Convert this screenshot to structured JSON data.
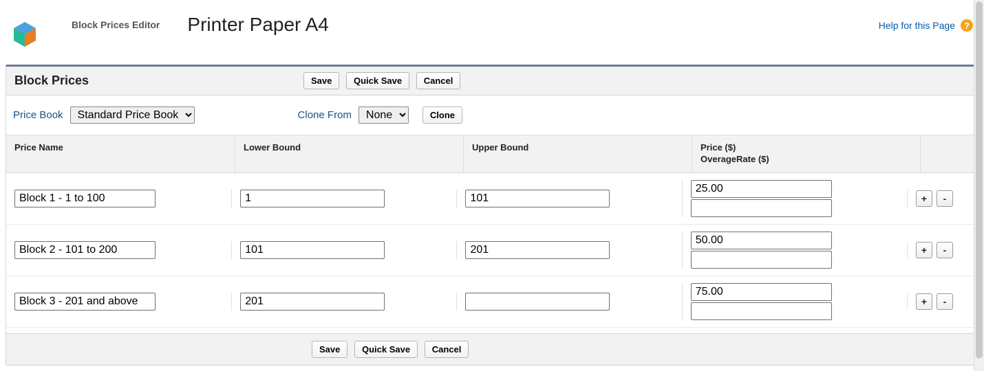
{
  "header": {
    "subtitle": "Block Prices Editor",
    "title": "Printer Paper A4",
    "help_label": "Help for this Page",
    "help_icon_char": "?"
  },
  "card": {
    "title": "Block Prices"
  },
  "buttons": {
    "save": "Save",
    "quick_save": "Quick Save",
    "cancel": "Cancel",
    "clone": "Clone",
    "add": "+",
    "remove": "-"
  },
  "filters": {
    "price_book_label": "Price Book",
    "price_book_value": "Standard Price Book",
    "clone_from_label": "Clone From",
    "clone_from_value": "None"
  },
  "columns": {
    "name": "Price Name",
    "lower": "Lower Bound",
    "upper": "Upper Bound",
    "price_line1": "Price ($)",
    "price_line2": "OverageRate ($)"
  },
  "rows": [
    {
      "name": "Block 1 - 1 to 100",
      "lower": "1",
      "upper": "101",
      "price": "25.00",
      "overage": ""
    },
    {
      "name": "Block 2 - 101 to 200",
      "lower": "101",
      "upper": "201",
      "price": "50.00",
      "overage": ""
    },
    {
      "name": "Block 3 - 201 and above",
      "lower": "201",
      "upper": "",
      "price": "75.00",
      "overage": ""
    }
  ]
}
